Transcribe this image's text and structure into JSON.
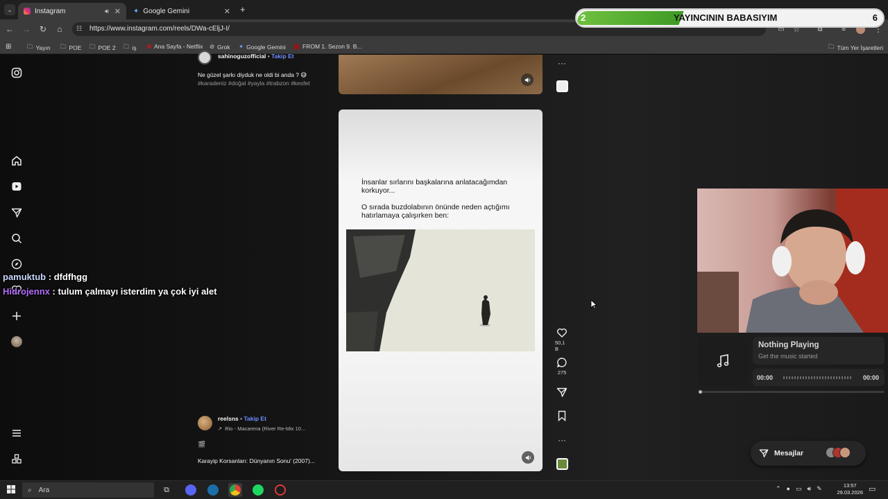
{
  "browser": {
    "tabs": [
      {
        "title": "Instagram",
        "active": true
      },
      {
        "title": "Google Gemini",
        "active": false
      }
    ],
    "new_tab": "+",
    "url": "https://www.instagram.com/reels/DWa-cEljJ-I/",
    "bookmarks": [
      "Yayın",
      "POE",
      "POE 2",
      "iş",
      "Ana Sayfa - Netflix",
      "Grok",
      "Google Gemini",
      "FROM 1. Sezon 9. B..."
    ],
    "all_bookmarks": "Tüm Yer İşaretleri"
  },
  "sub_goal": {
    "current": "2",
    "text": "YAYINCININ BABASIYIM",
    "target": "6",
    "progress_fraction": 0.333
  },
  "posts": {
    "top": {
      "username": "sahinoguzofficial",
      "follow": "Takip Et",
      "caption": "Ne güzel şarkı diyduk ne oldi bi anda ? 😅",
      "hashtags": "#karadeniz #doğal #yayla #trabzon #kesfet"
    },
    "main": {
      "text_line1": "İnsanlar sırlarını başkalarına anlatacağımdan korkuyor...",
      "text_line2": "O sırada buzdolabının önünde neden açtığımı hatırlamaya çalışırken ben:",
      "username": "reelsns",
      "follow": "Takip Et",
      "audio": "Rio - Macarena (River Re-Mix 10...",
      "caption_emoji": "🎬",
      "caption": "Karayip Korsanları: Dünyanın Sonu' (2007)..."
    }
  },
  "actions": {
    "likes": "50,1 B",
    "comments": "275"
  },
  "chat": [
    {
      "user": "pamuktub",
      "message": "dfdfhgg",
      "color": "#c9d7ff"
    },
    {
      "user": "Hidrojennx",
      "message": "tulum çalmayı isterdim ya çok iyi alet",
      "color": "#b56cff"
    }
  ],
  "music": {
    "title": "Nothing Playing",
    "subtitle": "Get the music started",
    "time_start": "00:00",
    "time_end": "00:00"
  },
  "messages_label": "Mesajlar",
  "taskbar": {
    "search_placeholder": "Ara",
    "time": "13:57",
    "date": "29.03.2026"
  }
}
